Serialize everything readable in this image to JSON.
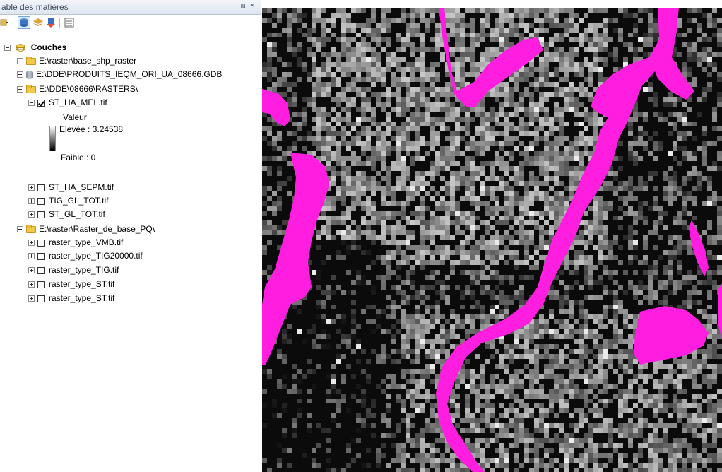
{
  "toc": {
    "title": "able des matières",
    "pin_glyph": "⩏",
    "close_glyph": "×",
    "toolbar": [
      "list-by-drawing-order-icon",
      "list-by-source-icon",
      "list-by-visibility-icon",
      "list-by-selection-icon",
      "options-icon"
    ],
    "root_label": "Couches",
    "items": [
      {
        "label": "E:\\raster\\base_shp_raster",
        "type": "folder",
        "expanded": false
      },
      {
        "label": "E:\\DDE\\PRODUITS_IEQM_ORI_UA_08666.GDB",
        "type": "gdb",
        "expanded": false
      },
      {
        "label": "E:\\DDE\\08666\\RASTERS\\",
        "type": "folder",
        "expanded": true
      },
      {
        "label": "ST_HA_MEL.tif",
        "type": "layer",
        "checked": true,
        "expanded": true
      },
      {
        "label": "ST_HA_SEPM.tif",
        "type": "layer",
        "checked": false,
        "expanded": false
      },
      {
        "label": "TIG_GL_TOT.tif",
        "type": "layer",
        "checked": false,
        "expanded": false
      },
      {
        "label": "ST_GL_TOT.tif",
        "type": "layer",
        "checked": false,
        "expanded": false
      },
      {
        "label": "E:\\raster\\Raster_de_base_PQ\\",
        "type": "folder",
        "expanded": true
      },
      {
        "label": "raster_type_VMB.tif",
        "type": "layer",
        "checked": false,
        "expanded": false
      },
      {
        "label": "raster_type_TIG20000.tif",
        "type": "layer",
        "checked": false,
        "expanded": false
      },
      {
        "label": "raster_type_TIG.tif",
        "type": "layer",
        "checked": false,
        "expanded": false
      },
      {
        "label": "raster_type_ST.tif",
        "type": "layer",
        "checked": false,
        "expanded": false
      },
      {
        "label": "raster_type_ST.tif",
        "type": "layer",
        "checked": false,
        "expanded": false
      }
    ],
    "legend": {
      "heading": "Valeur",
      "high": "Elevée : 3.24538",
      "low": "Faible : 0"
    }
  },
  "map": {
    "background": "#0b0b0b",
    "nodata_color": "#ff1ee0",
    "description_icon": "raster-map-view"
  }
}
